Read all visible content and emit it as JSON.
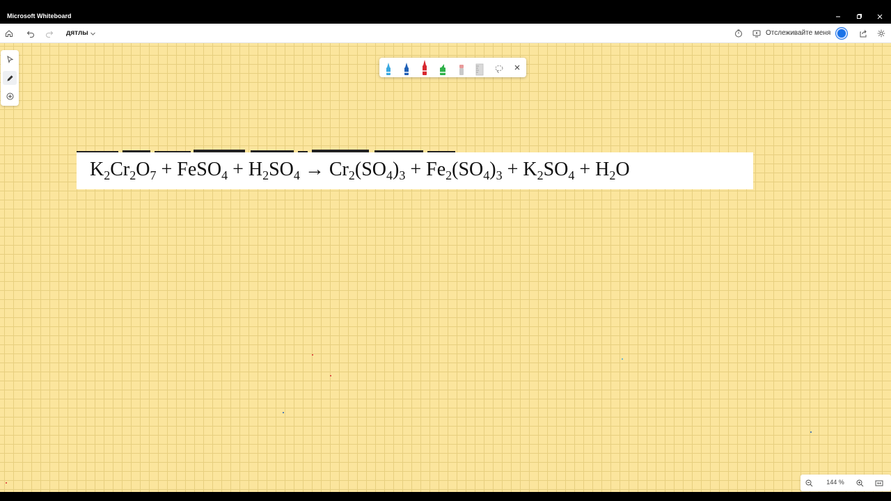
{
  "window": {
    "title": "Microsoft Whiteboard",
    "controls": [
      "minimize-icon",
      "restore-icon",
      "close-icon"
    ]
  },
  "toolbar": {
    "board_name": "дятлы",
    "follow_label": "Отслеживайте меня",
    "left_icons": [
      "home-icon",
      "undo-icon",
      "redo-icon"
    ],
    "right_icons": [
      "timer-icon",
      "follow-icon",
      "share-icon",
      "settings-icon"
    ],
    "avatar_color": "#1a73e8"
  },
  "left_rail": [
    "select-icon",
    "pen-icon",
    "add-icon"
  ],
  "ink_toolbar": {
    "tools": [
      {
        "name": "pen-light-blue",
        "color": "#39a8e0"
      },
      {
        "name": "pen-dark-blue",
        "color": "#1f5fb5"
      },
      {
        "name": "pen-red",
        "color": "#d8282f",
        "selected": true
      },
      {
        "name": "highlighter-green",
        "color": "#2fb14a"
      },
      {
        "name": "eraser",
        "color": "#e89a9a"
      },
      {
        "name": "ruler",
        "color": "#bdbdbd"
      },
      {
        "name": "lasso",
        "color": "#888888"
      }
    ]
  },
  "canvas": {
    "background": "#fbe59d",
    "grid_color": "#e7cf7f"
  },
  "equation": {
    "pieces": {
      "t1": "K",
      "s1": "2",
      "t2": "Cr",
      "s2": "2",
      "t3": "O",
      "s3": "7",
      "p1": " + FeSO",
      "s4": "4",
      "p2": " + H",
      "s5": "2",
      "t4": "SO",
      "s6": "4",
      "arrow": " → Cr",
      "s7": "2",
      "t5": "(SO",
      "s8": "4",
      "t6": ")",
      "s9": "3",
      "p3": " + Fe",
      "s10": "2",
      "t7": "(SO",
      "s11": "4",
      "t8": ")",
      "s12": "3",
      "p4": " + K",
      "s13": "2",
      "t9": "SO",
      "s14": "4",
      "p5": " + H",
      "s15": "2",
      "t10": "O"
    }
  },
  "zoom": {
    "value": "144 %"
  }
}
